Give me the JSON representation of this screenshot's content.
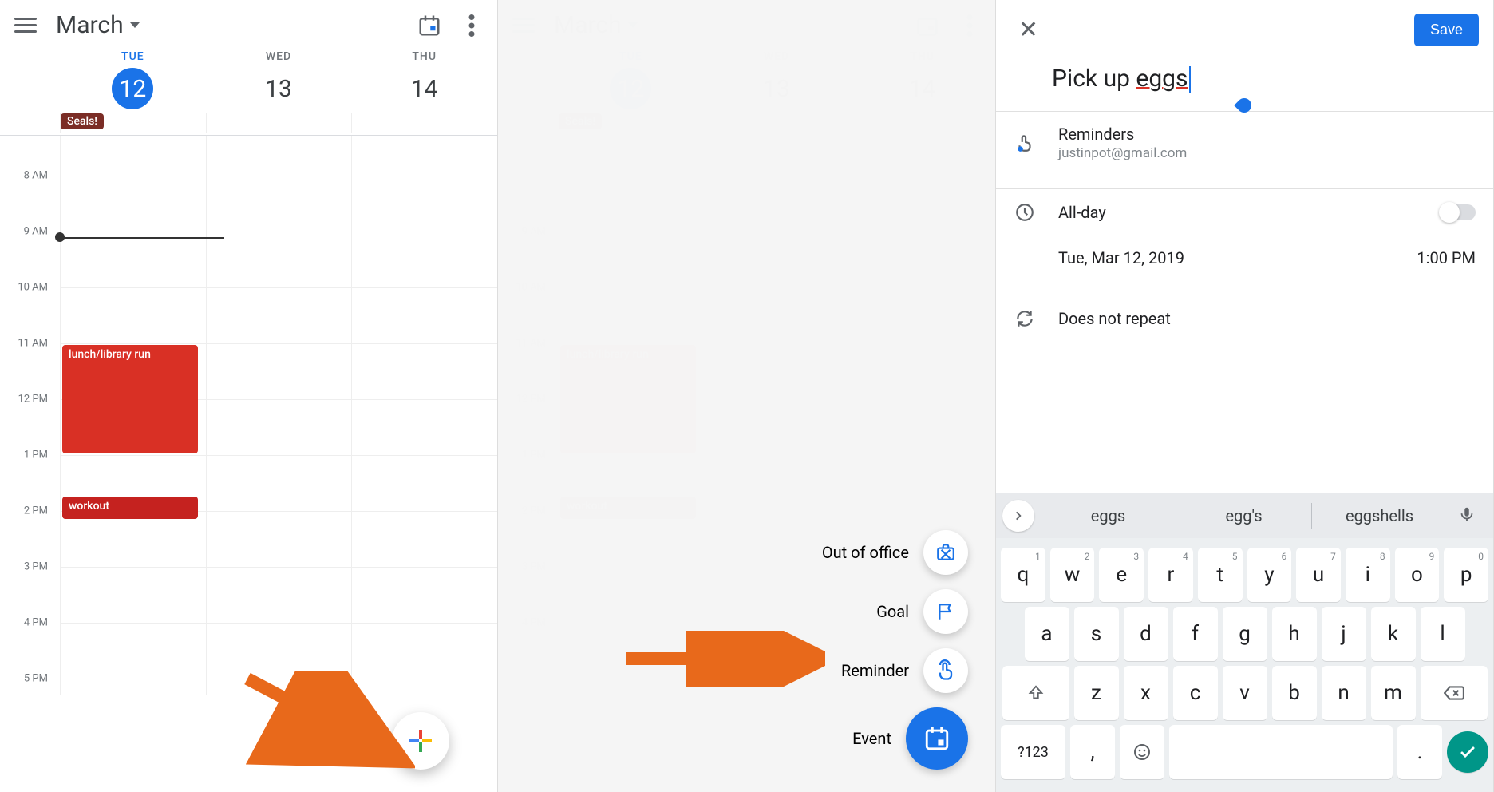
{
  "panel1": {
    "month": "March",
    "days": [
      {
        "dow": "TUE",
        "num": "12",
        "selected": true
      },
      {
        "dow": "WED",
        "num": "13",
        "selected": false
      },
      {
        "dow": "THU",
        "num": "14",
        "selected": false
      }
    ],
    "allday_event": "Seals!",
    "hours": [
      "8 AM",
      "9 AM",
      "10 AM",
      "11 AM",
      "12 PM",
      "1 PM",
      "2 PM",
      "3 PM",
      "4 PM",
      "5 PM"
    ],
    "events": {
      "lunch": "lunch/library run",
      "workout": "workout"
    }
  },
  "panel2": {
    "speeddial": {
      "out_of_office": "Out of office",
      "goal": "Goal",
      "reminder": "Reminder",
      "event": "Event"
    }
  },
  "panel3": {
    "save": "Save",
    "title_plain": "Pick up ",
    "title_underlined": "eggs",
    "reminders_label": "Reminders",
    "account": "justinpot@gmail.com",
    "allday_label": "All-day",
    "date": "Tue, Mar 12, 2019",
    "time": "1:00 PM",
    "repeat": "Does not repeat",
    "suggestions": [
      "eggs",
      "egg's",
      "eggshells"
    ],
    "keyboard": {
      "row1": [
        [
          "q",
          "1"
        ],
        [
          "w",
          "2"
        ],
        [
          "e",
          "3"
        ],
        [
          "r",
          "4"
        ],
        [
          "t",
          "5"
        ],
        [
          "y",
          "6"
        ],
        [
          "u",
          "7"
        ],
        [
          "i",
          "8"
        ],
        [
          "o",
          "9"
        ],
        [
          "p",
          "0"
        ]
      ],
      "row2": [
        "a",
        "s",
        "d",
        "f",
        "g",
        "h",
        "j",
        "k",
        "l"
      ],
      "row3": [
        "z",
        "x",
        "c",
        "v",
        "b",
        "n",
        "m"
      ],
      "sym": "?123",
      "comma": ",",
      "period": "."
    }
  },
  "colors": {
    "blue": "#1a73e8",
    "red": "#d93025",
    "maroon": "#7b2d26",
    "orange": "#e8691b",
    "teal": "#009688"
  }
}
